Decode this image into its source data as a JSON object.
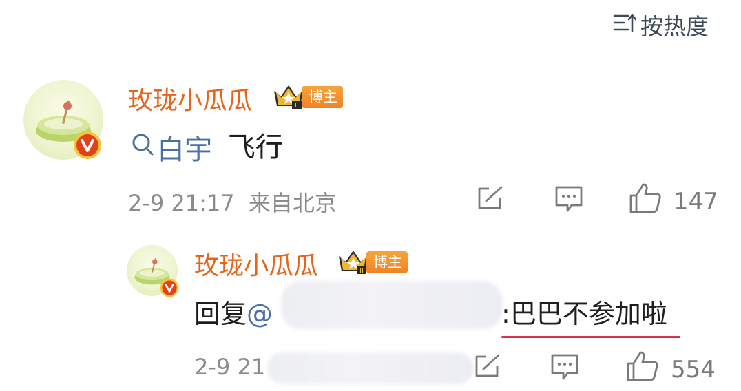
{
  "sort": {
    "label": "按热度",
    "icon": "sort-icon"
  },
  "comment": {
    "username": "玫珑小瓜瓜",
    "badge_label": "博主",
    "topic": "白宇",
    "text": "飞行",
    "timestamp": "2-9 21:17",
    "location": "来自北京",
    "like_count": "147"
  },
  "reply": {
    "username": "玫珑小瓜瓜",
    "badge_label": "博主",
    "prefix": "回复",
    "mention_at": "@",
    "separator": ":",
    "text": "巴巴不参加啦",
    "timestamp_partial": "2-9 21",
    "like_count": "554"
  },
  "colors": {
    "username": "#e8641b",
    "link": "#4a6fa5",
    "meta": "#8b8b8b",
    "underline": "#d8334a",
    "badge": "#f0902c",
    "verified": "#e0421b"
  }
}
